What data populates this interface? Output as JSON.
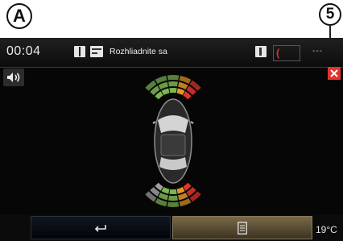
{
  "callouts": {
    "a": "A",
    "five": "5"
  },
  "status_bar": {
    "time": "00:04",
    "message": "Rozhliadnite sa",
    "signal": "---"
  },
  "icons": {
    "book": "book-icon",
    "camera_view": "camera-view-icon",
    "phone": "phone-icon",
    "call": "phone-handset-icon",
    "volume": "speaker-icon",
    "close": "close-icon",
    "back": "return-arrow-icon",
    "menu": "menu-list-icon"
  },
  "footer": {
    "temperature": "19°C"
  },
  "colors": {
    "sensor_green": "#7db552",
    "sensor_orange": "#e3942c",
    "sensor_red": "#e2362b",
    "sensor_grey": "#a0a0a0",
    "close_red": "#e8322e",
    "menu_active": "#7a6a46"
  },
  "parking_sensors": {
    "front": [
      "green",
      "green",
      "green",
      "orange",
      "red"
    ],
    "rear": [
      "grey",
      "green",
      "green",
      "orange",
      "red"
    ]
  }
}
